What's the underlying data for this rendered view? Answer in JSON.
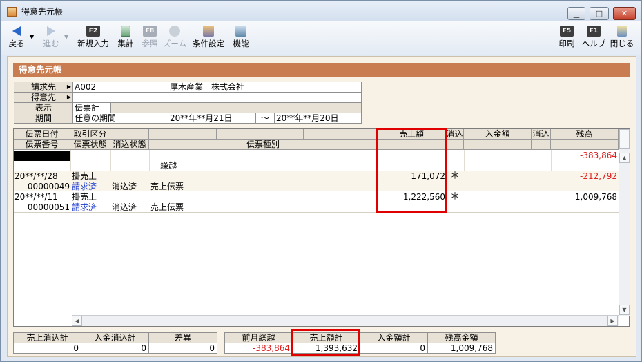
{
  "window": {
    "title": "得意先元帳",
    "minimize": "▁",
    "maximize": "□",
    "close": "✕"
  },
  "toolbar": {
    "back": {
      "label": "戻る",
      "icon": "back-arrow-icon"
    },
    "forward": {
      "label": "進む",
      "icon": "forward-arrow-icon"
    },
    "new_entry": {
      "key": "F2",
      "label": "新規入力"
    },
    "aggregate": {
      "label": "集計",
      "icon": "calculator-icon"
    },
    "refer": {
      "key": "F8",
      "label": "参照"
    },
    "zoom": {
      "label": "ズーム",
      "icon": "zoom-icon"
    },
    "conditions": {
      "label": "条件設定",
      "icon": "conditions-icon"
    },
    "functions": {
      "label": "機能",
      "icon": "functions-icon"
    },
    "print": {
      "key": "F5",
      "label": "印刷"
    },
    "help": {
      "key": "F1",
      "label": "ヘルプ"
    },
    "close": {
      "label": "閉じる",
      "icon": "exit-icon"
    }
  },
  "panel": {
    "title": "得意先元帳"
  },
  "criteria": {
    "billing_label": "請求先",
    "billing_code": "A002",
    "billing_name": "厚木産業　株式会社",
    "customer_label": "得意先",
    "customer_code": "",
    "display_label": "表示",
    "display_value": "伝票計",
    "period_label": "期間",
    "period_type": "任意の期間",
    "period_from": "20**年**月21日",
    "period_sep": "～",
    "period_to": "20**年**月20日"
  },
  "grid": {
    "headers_row1": {
      "date": "伝票日付",
      "trade_type": "取引区分",
      "sales": "売上額",
      "sales_cleared": "消込",
      "payment": "入金額",
      "payment_cleared": "消込",
      "balance": "残高"
    },
    "headers_row2": {
      "slip_no": "伝票番号",
      "slip_status": "伝票状態",
      "clear_status": "消込状態",
      "slip_type": "伝票種別"
    },
    "rows": [
      {
        "date": "",
        "slip_no": "",
        "trade_type": "",
        "slip_status": "",
        "clear_status": "",
        "slip_type": "繰越",
        "sales": "",
        "sales_mark": "",
        "payment": "",
        "balance": "-383,864"
      },
      {
        "date": "20**/**/28",
        "slip_no": "00000049",
        "trade_type": "掛売上",
        "slip_status": "請求済",
        "clear_status": "消込済",
        "slip_type": "売上伝票",
        "sales": "171,072",
        "sales_mark": "＊",
        "payment": "",
        "balance": "-212,792"
      },
      {
        "date": "20**/**/11",
        "slip_no": "00000051",
        "trade_type": "掛売上",
        "slip_status": "請求済",
        "clear_status": "消込済",
        "slip_type": "売上伝票",
        "sales": "1,222,560",
        "sales_mark": "＊",
        "payment": "",
        "balance": "1,009,768"
      }
    ]
  },
  "totals": {
    "sales_cleared_label": "売上消込計",
    "sales_cleared": "0",
    "payment_cleared_label": "入金消込計",
    "payment_cleared": "0",
    "diff_label": "差異",
    "diff": "0",
    "prev_carry_label": "前月繰越",
    "prev_carry": "-383,864",
    "sales_total_label": "売上額計",
    "sales_total": "1,393,632",
    "payment_total_label": "入金額計",
    "payment_total": "0",
    "balance_total_label": "残高金額",
    "balance_total": "1,009,768"
  },
  "colors": {
    "header_bar": "#c87c50",
    "negative": "#e02020",
    "status_link": "#1f3fd0",
    "highlight": "#e00000"
  }
}
